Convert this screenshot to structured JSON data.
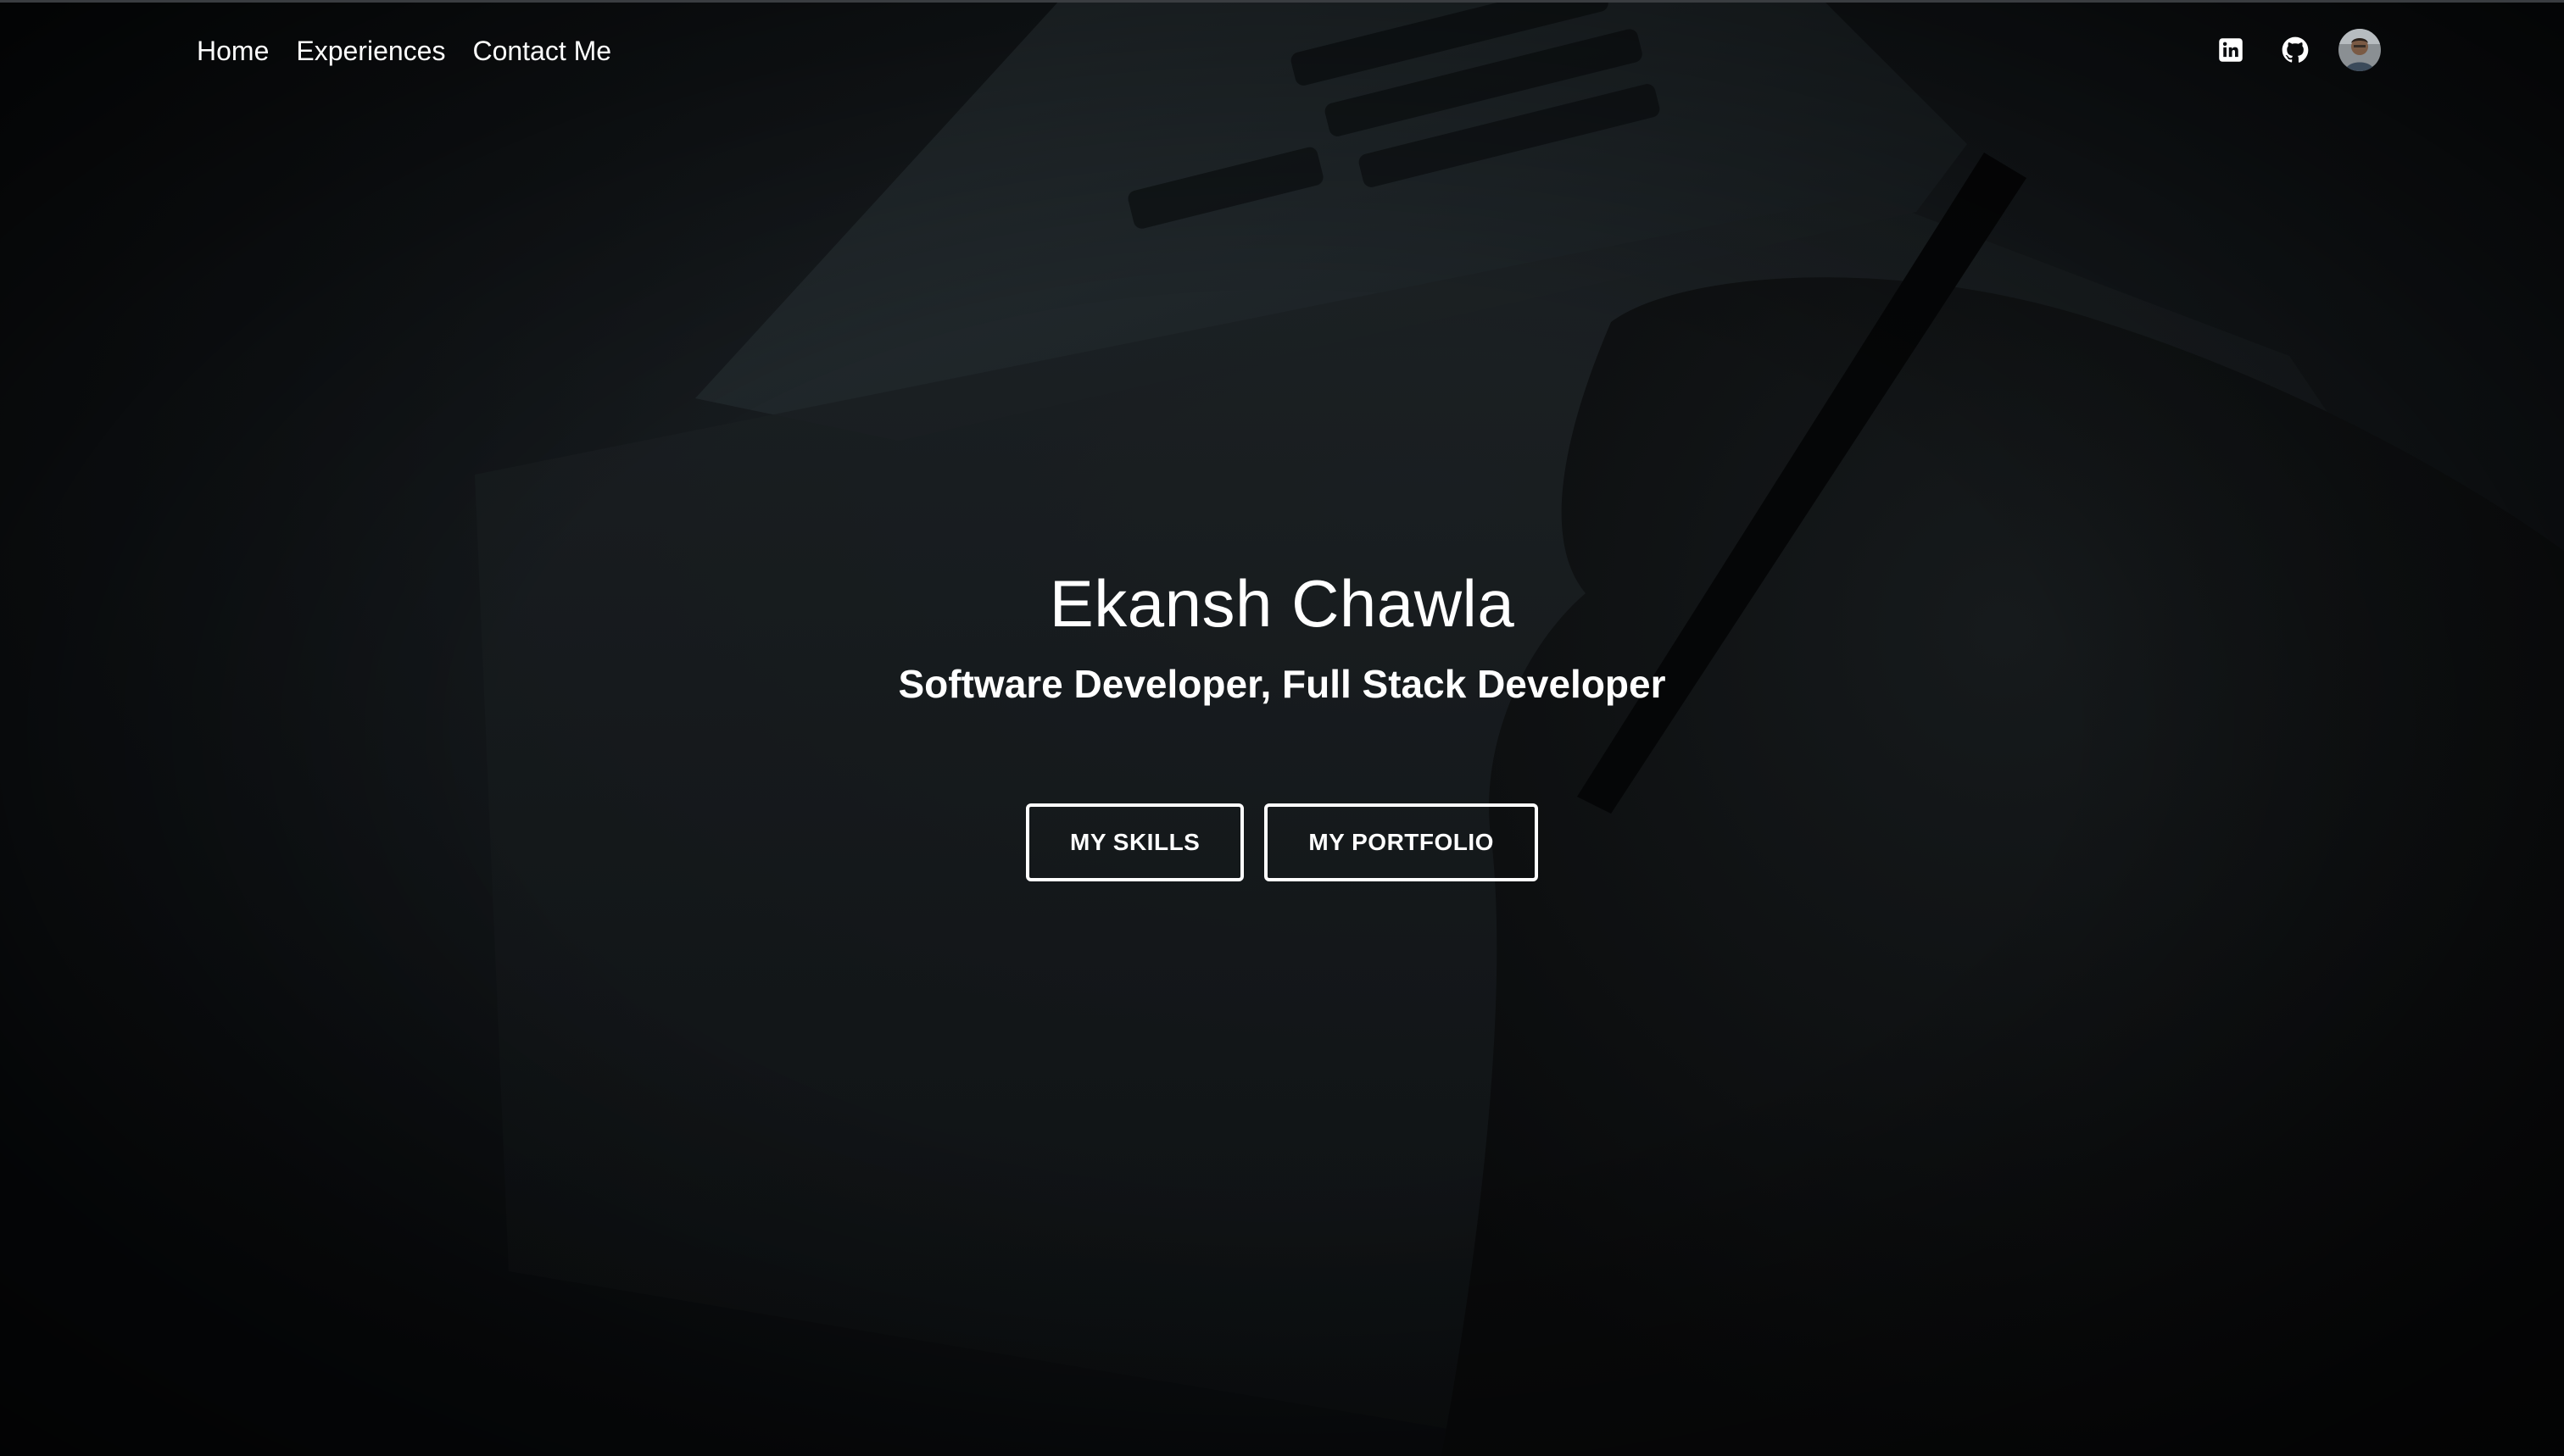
{
  "nav": {
    "links": [
      {
        "label": "Home"
      },
      {
        "label": "Experiences"
      },
      {
        "label": "Contact Me"
      }
    ],
    "icons": [
      "linkedin-icon",
      "github-icon",
      "avatar"
    ]
  },
  "hero": {
    "name": "Ekansh Chawla",
    "subtitle": "Software Developer, Full Stack Developer",
    "buttons": [
      {
        "label": "MY SKILLS"
      },
      {
        "label": "MY PORTFOLIO"
      }
    ]
  },
  "colors": {
    "background": "#0b0d10",
    "text": "#ffffff",
    "button_border": "#ffffff"
  }
}
